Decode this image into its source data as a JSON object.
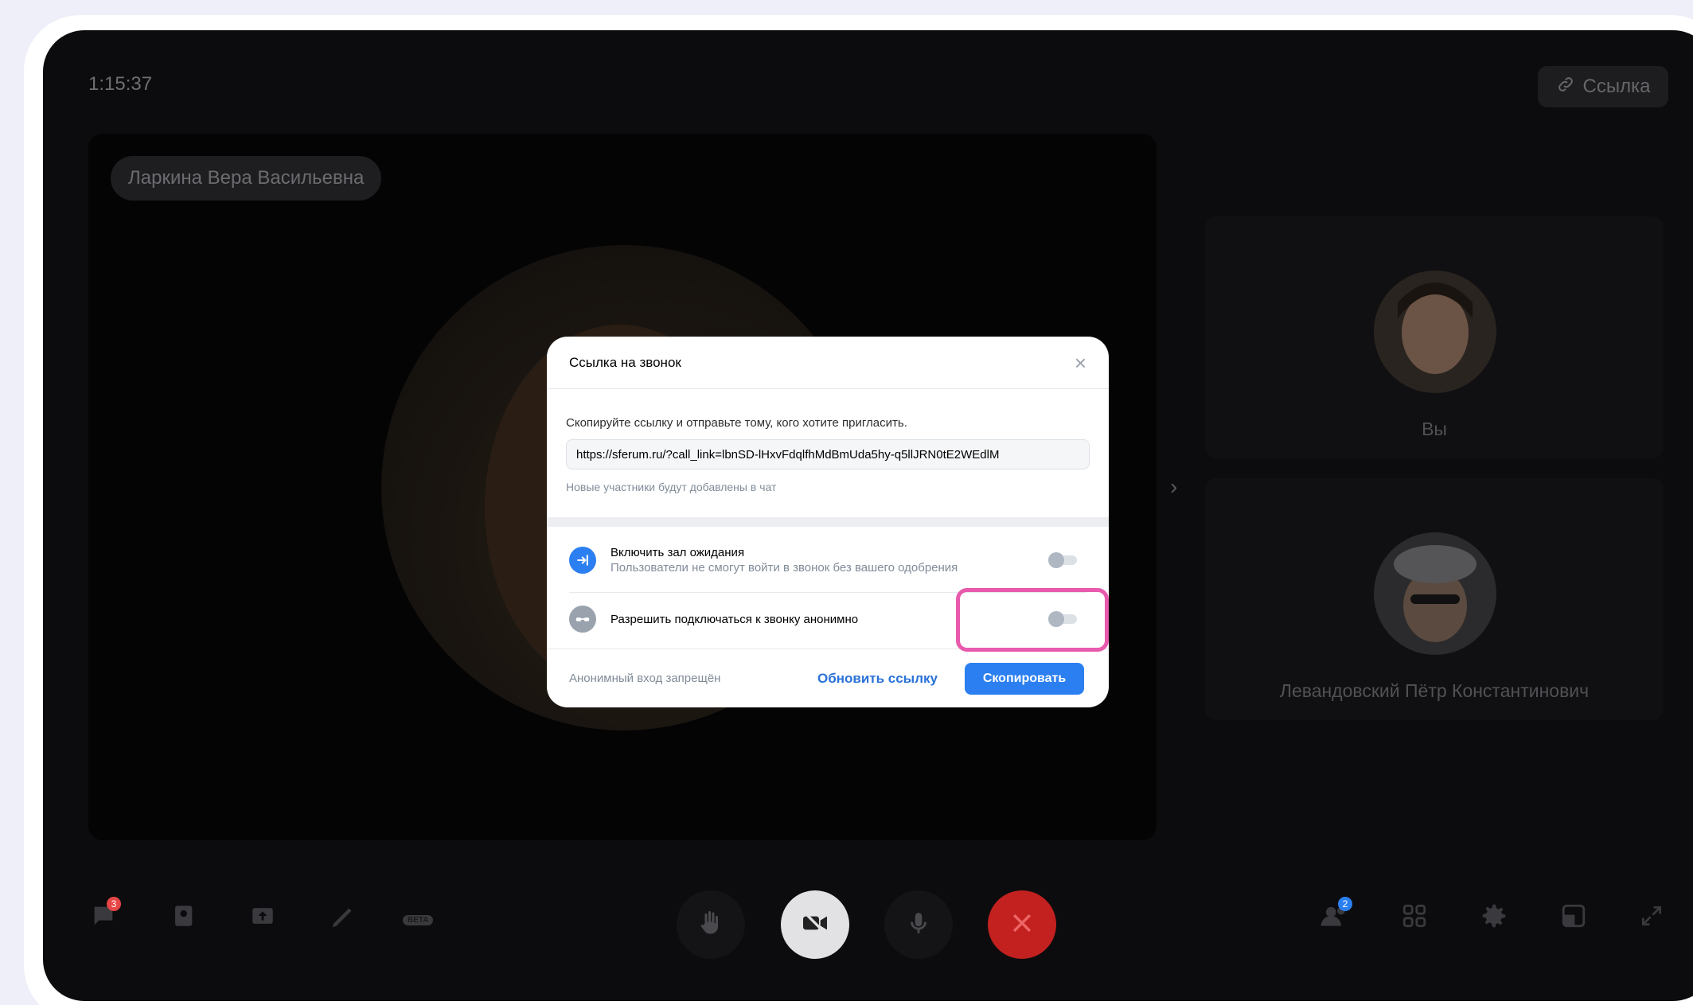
{
  "call": {
    "timer": "1:15:37",
    "link_button_label": "Ссылка",
    "speaker_name": "Ларкина Вера Васильевна",
    "participants": [
      {
        "name": "Вы"
      },
      {
        "name": "Левандовский Пётр Константинович"
      }
    ],
    "chat_badge": "3",
    "participants_badge": "2",
    "beta_label": "BETA"
  },
  "modal": {
    "title": "Ссылка на звонок",
    "description": "Скопируйте ссылку и отправьте тому, кого хотите пригласить.",
    "link_value": "https://sferum.ru/?call_link=lbnSD-lHxvFdqlfhMdBmUda5hy-q5llJRN0tE2WEdlM",
    "hint": "Новые участники будут добавлены в чат",
    "options": [
      {
        "title": "Включить зал ожидания",
        "subtitle": "Пользователи не смогут войти в звонок без вашего одобрения",
        "enabled": false
      },
      {
        "title": "Разрешить подключаться к звонку анонимно",
        "enabled": false
      }
    ],
    "anon_status": "Анонимный вход запрещён",
    "refresh_label": "Обновить ссылку",
    "copy_label": "Скопировать"
  },
  "colors": {
    "accent": "#2b7ff0",
    "highlight": "#e85aad",
    "end_call": "#c2211f"
  }
}
